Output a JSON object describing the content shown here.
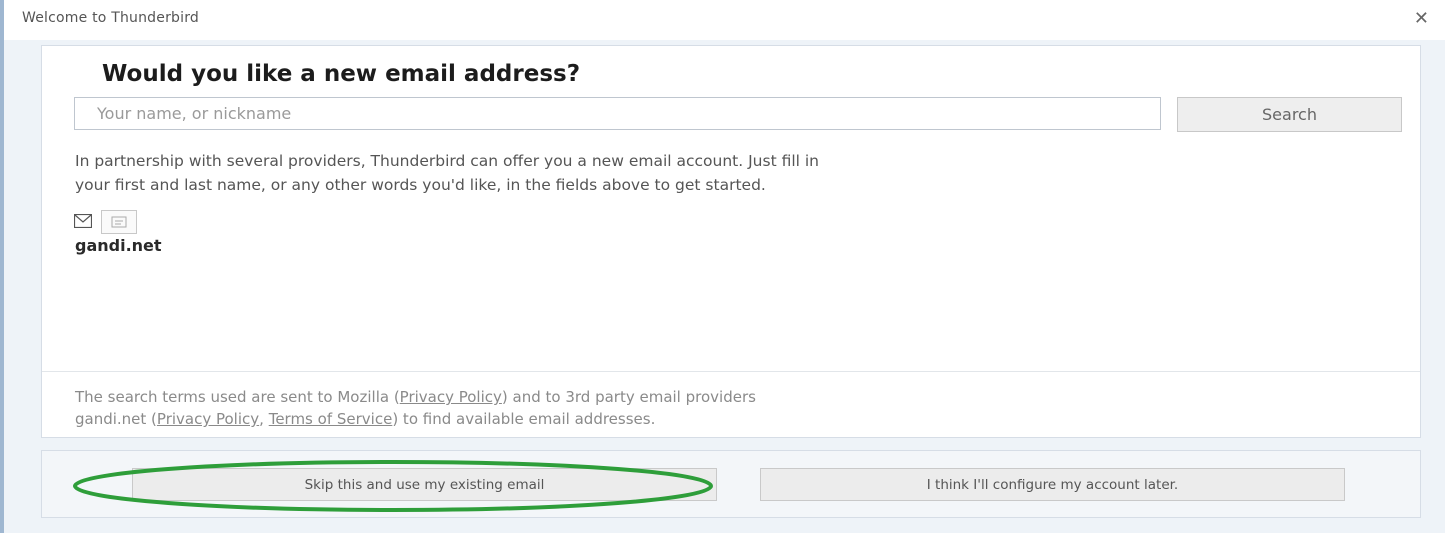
{
  "window": {
    "title": "Welcome to Thunderbird",
    "close_symbol": "✕"
  },
  "main": {
    "heading": "Would you like a new email address?",
    "search_placeholder": "Your name, or nickname",
    "search_button": "Search",
    "description_line1": "In partnership with several providers, Thunderbird can offer you a new email account. Just fill in",
    "description_line2": "your first and last name, or any other words you'd like, in the fields above to get started.",
    "provider_name": "gandi.net",
    "icons": [
      "mail-icon",
      "provider-logo-icon"
    ],
    "terms": {
      "part1": "The search terms used are sent to Mozilla (",
      "privacy_link_mozilla": "Privacy Policy",
      "part2": ") and to 3rd party email providers",
      "provider": "gandi.net (",
      "privacy_link_provider": "Privacy Policy",
      "sep": ", ",
      "tos_link": "Terms of Service",
      "part3": ") to find available email addresses."
    }
  },
  "footer": {
    "skip_button": "Skip this and use my existing email",
    "later_button": "I think I'll configure my account later.",
    "highlight_color": "#2e9e3a"
  }
}
